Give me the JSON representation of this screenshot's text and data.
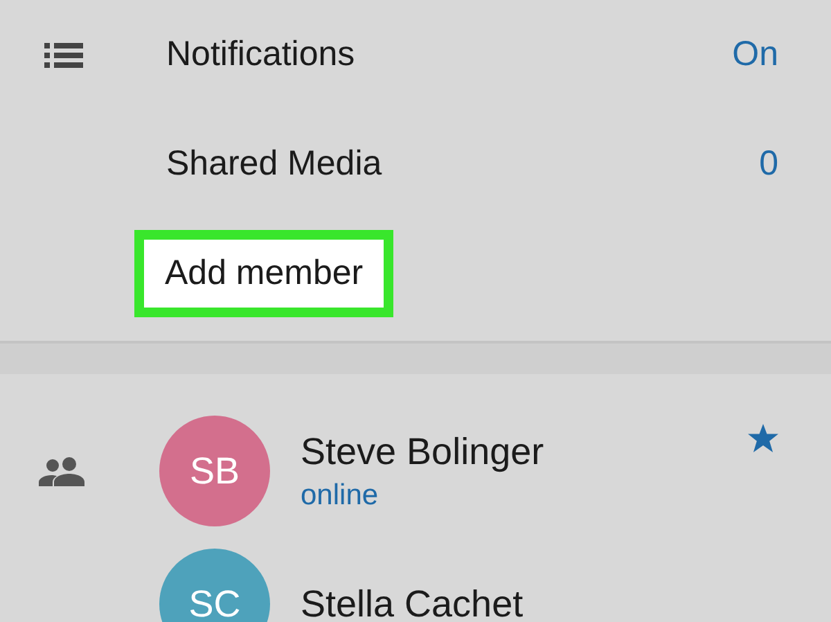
{
  "settings": [
    {
      "label": "Notifications",
      "value": "On",
      "highlighted": false
    },
    {
      "label": "Shared Media",
      "value": "0",
      "highlighted": false
    },
    {
      "label": "Add member",
      "highlighted": true
    }
  ],
  "members": [
    {
      "initials": "SB",
      "name": "Steve Bolinger",
      "status": "online",
      "color": "#d36f8d",
      "starred": true
    },
    {
      "initials": "SC",
      "name": "Stella Cachet",
      "color": "#4ea2bb",
      "starred": false
    }
  ]
}
